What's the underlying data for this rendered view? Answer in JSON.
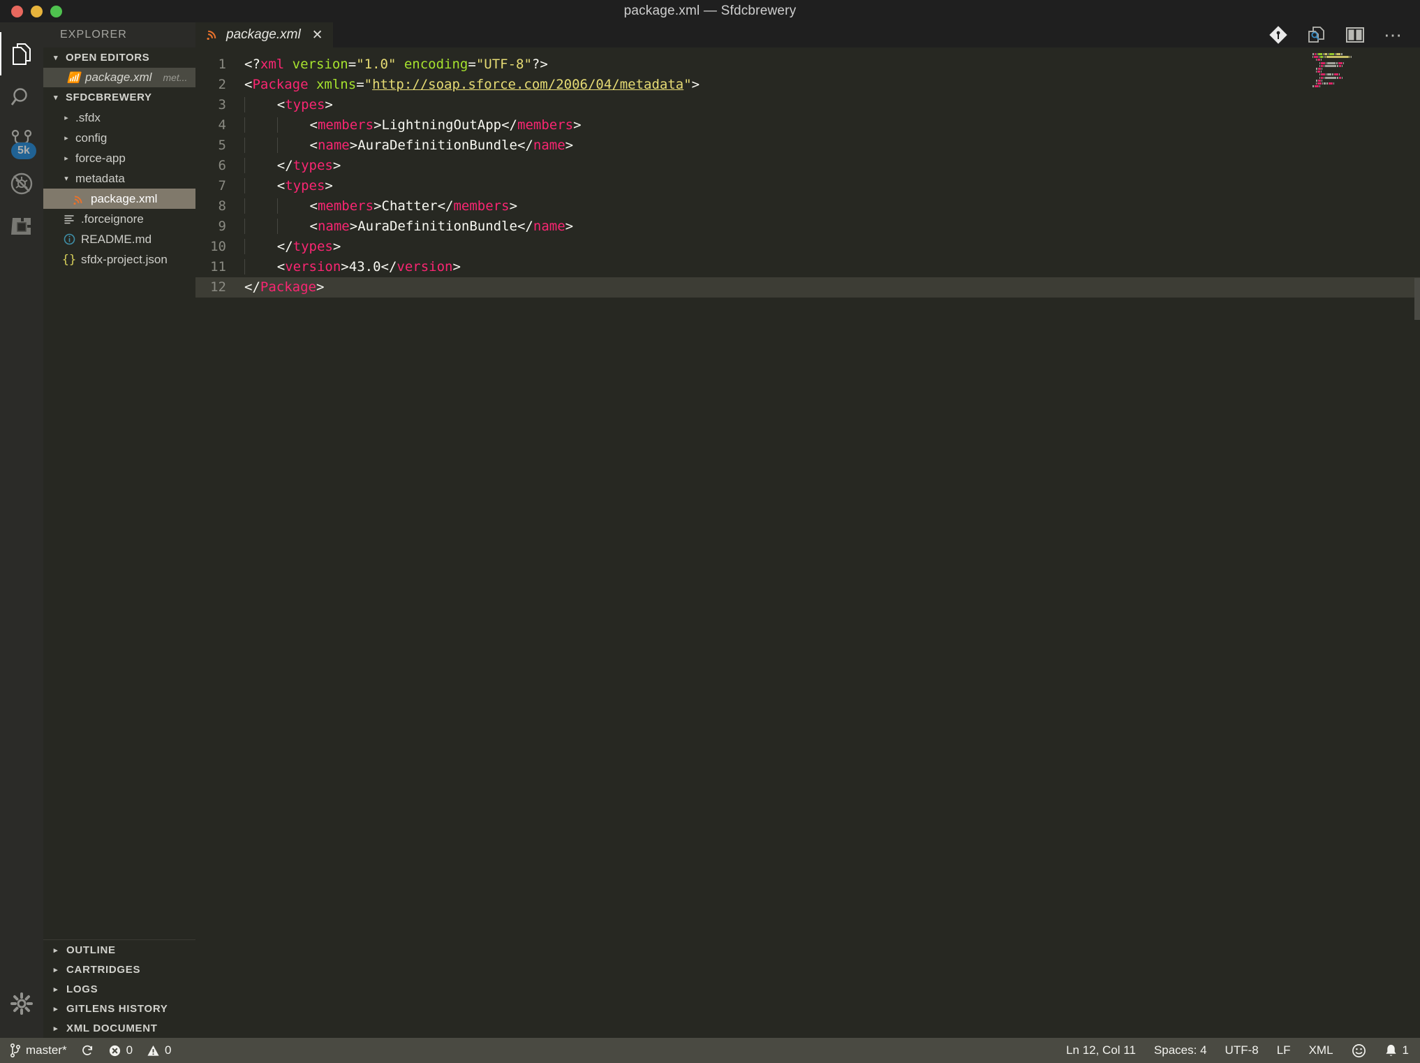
{
  "window": {
    "title": "package.xml — Sfdcbrewery",
    "traffic_lights": [
      "close-red",
      "minimize-yellow",
      "maximize-green"
    ]
  },
  "activitybar": {
    "items": [
      {
        "name": "explorer",
        "icon": "files-icon",
        "active": true,
        "badge": null
      },
      {
        "name": "search",
        "icon": "search-icon",
        "active": false,
        "badge": null
      },
      {
        "name": "source-control",
        "icon": "source-control-icon",
        "active": false,
        "badge": "5k"
      },
      {
        "name": "debug",
        "icon": "debug-no-entry-icon",
        "active": false,
        "badge": null
      },
      {
        "name": "extensions",
        "icon": "extensions-icon",
        "active": false,
        "badge": null
      }
    ],
    "manage": {
      "name": "settings-gear",
      "icon": "gear-icon"
    }
  },
  "sidebar": {
    "title": "EXPLORER",
    "open_editors": {
      "label": "OPEN EDITORS",
      "expanded": true,
      "items": [
        {
          "icon": "xml-file-icon",
          "name": "package.xml",
          "path": "met...",
          "active": true
        }
      ]
    },
    "project": {
      "label": "SFDCBREWERY",
      "expanded": true,
      "tree": [
        {
          "label": ".sfdx",
          "type": "folder",
          "expanded": false,
          "depth": 1,
          "icon": "chevron-right-icon"
        },
        {
          "label": "config",
          "type": "folder",
          "expanded": false,
          "depth": 1,
          "icon": "chevron-right-icon"
        },
        {
          "label": "force-app",
          "type": "folder",
          "expanded": false,
          "depth": 1,
          "icon": "chevron-right-icon"
        },
        {
          "label": "metadata",
          "type": "folder",
          "expanded": true,
          "depth": 1,
          "icon": "chevron-down-icon"
        },
        {
          "label": "package.xml",
          "type": "file",
          "depth": 2,
          "icon": "xml-file-icon",
          "selected": true
        },
        {
          "label": ".forceignore",
          "type": "file",
          "depth": 1,
          "icon": "text-file-icon"
        },
        {
          "label": "README.md",
          "type": "file",
          "depth": 1,
          "icon": "info-circle-icon"
        },
        {
          "label": "sfdx-project.json",
          "type": "file",
          "depth": 1,
          "icon": "json-braces-icon"
        }
      ]
    },
    "panels": [
      {
        "label": "OUTLINE",
        "expanded": false,
        "icon": "chevron-right-icon"
      },
      {
        "label": "CARTRIDGES",
        "expanded": false,
        "icon": "chevron-right-icon"
      },
      {
        "label": "LOGS",
        "expanded": false,
        "icon": "chevron-right-icon"
      },
      {
        "label": "GITLENS HISTORY",
        "expanded": false,
        "icon": "chevron-right-icon"
      },
      {
        "label": "XML DOCUMENT",
        "expanded": false,
        "icon": "chevron-right-icon"
      }
    ]
  },
  "editor": {
    "tabs": [
      {
        "label": "package.xml",
        "icon": "xml-file-icon",
        "active": true,
        "dirty": false,
        "close": "✕"
      }
    ],
    "actions": [
      {
        "name": "source-control-action",
        "icon": "git-diamond-icon"
      },
      {
        "name": "find-in-file-action",
        "icon": "search-document-icon"
      },
      {
        "name": "split-editor-action",
        "icon": "split-editor-icon"
      },
      {
        "name": "more-actions",
        "icon": "ellipsis-icon"
      }
    ],
    "lines": [
      {
        "n": 1,
        "indent": 0,
        "tokens": [
          {
            "t": "<?",
            "c": "plain"
          },
          {
            "t": "xml",
            "c": "tag"
          },
          {
            "t": " ",
            "c": "plain"
          },
          {
            "t": "version",
            "c": "attr"
          },
          {
            "t": "=",
            "c": "plain"
          },
          {
            "t": "\"1.0\"",
            "c": "str"
          },
          {
            "t": " ",
            "c": "plain"
          },
          {
            "t": "encoding",
            "c": "attr"
          },
          {
            "t": "=",
            "c": "plain"
          },
          {
            "t": "\"UTF-8\"",
            "c": "str"
          },
          {
            "t": "?>",
            "c": "plain"
          }
        ]
      },
      {
        "n": 2,
        "indent": 0,
        "tokens": [
          {
            "t": "<",
            "c": "plain"
          },
          {
            "t": "Package",
            "c": "tag"
          },
          {
            "t": " ",
            "c": "plain"
          },
          {
            "t": "xmlns",
            "c": "attr"
          },
          {
            "t": "=",
            "c": "plain"
          },
          {
            "t": "\"",
            "c": "str"
          },
          {
            "t": "http://soap.sforce.com/2006/04/metadata",
            "c": "link"
          },
          {
            "t": "\"",
            "c": "str"
          },
          {
            "t": ">",
            "c": "plain"
          }
        ]
      },
      {
        "n": 3,
        "indent": 1,
        "tokens": [
          {
            "t": "<",
            "c": "plain"
          },
          {
            "t": "types",
            "c": "tag"
          },
          {
            "t": ">",
            "c": "plain"
          }
        ]
      },
      {
        "n": 4,
        "indent": 2,
        "tokens": [
          {
            "t": "<",
            "c": "plain"
          },
          {
            "t": "members",
            "c": "tag"
          },
          {
            "t": ">",
            "c": "plain"
          },
          {
            "t": "LightningOutApp",
            "c": "plain"
          },
          {
            "t": "</",
            "c": "plain"
          },
          {
            "t": "members",
            "c": "tag"
          },
          {
            "t": ">",
            "c": "plain"
          }
        ]
      },
      {
        "n": 5,
        "indent": 2,
        "tokens": [
          {
            "t": "<",
            "c": "plain"
          },
          {
            "t": "name",
            "c": "tag"
          },
          {
            "t": ">",
            "c": "plain"
          },
          {
            "t": "AuraDefinitionBundle",
            "c": "plain"
          },
          {
            "t": "</",
            "c": "plain"
          },
          {
            "t": "name",
            "c": "tag"
          },
          {
            "t": ">",
            "c": "plain"
          }
        ]
      },
      {
        "n": 6,
        "indent": 1,
        "tokens": [
          {
            "t": "</",
            "c": "plain"
          },
          {
            "t": "types",
            "c": "tag"
          },
          {
            "t": ">",
            "c": "plain"
          }
        ]
      },
      {
        "n": 7,
        "indent": 1,
        "tokens": [
          {
            "t": "<",
            "c": "plain"
          },
          {
            "t": "types",
            "c": "tag"
          },
          {
            "t": ">",
            "c": "plain"
          }
        ]
      },
      {
        "n": 8,
        "indent": 2,
        "tokens": [
          {
            "t": "<",
            "c": "plain"
          },
          {
            "t": "members",
            "c": "tag"
          },
          {
            "t": ">",
            "c": "plain"
          },
          {
            "t": "Chatter",
            "c": "plain"
          },
          {
            "t": "</",
            "c": "plain"
          },
          {
            "t": "members",
            "c": "tag"
          },
          {
            "t": ">",
            "c": "plain"
          }
        ]
      },
      {
        "n": 9,
        "indent": 2,
        "tokens": [
          {
            "t": "<",
            "c": "plain"
          },
          {
            "t": "name",
            "c": "tag"
          },
          {
            "t": ">",
            "c": "plain"
          },
          {
            "t": "AuraDefinitionBundle",
            "c": "plain"
          },
          {
            "t": "</",
            "c": "plain"
          },
          {
            "t": "name",
            "c": "tag"
          },
          {
            "t": ">",
            "c": "plain"
          }
        ]
      },
      {
        "n": 10,
        "indent": 1,
        "tokens": [
          {
            "t": "</",
            "c": "plain"
          },
          {
            "t": "types",
            "c": "tag"
          },
          {
            "t": ">",
            "c": "plain"
          }
        ]
      },
      {
        "n": 11,
        "indent": 1,
        "tokens": [
          {
            "t": "<",
            "c": "plain"
          },
          {
            "t": "version",
            "c": "tag"
          },
          {
            "t": ">",
            "c": "plain"
          },
          {
            "t": "43.0",
            "c": "plain"
          },
          {
            "t": "</",
            "c": "plain"
          },
          {
            "t": "version",
            "c": "tag"
          },
          {
            "t": ">",
            "c": "plain"
          }
        ]
      },
      {
        "n": 12,
        "indent": 0,
        "current": true,
        "tokens": [
          {
            "t": "</",
            "c": "plain"
          },
          {
            "t": "Package",
            "c": "tag"
          },
          {
            "t": ">",
            "c": "plain"
          }
        ]
      }
    ]
  },
  "statusbar": {
    "left": [
      {
        "name": "git-branch",
        "icon": "git-branch-icon",
        "label": "master*"
      },
      {
        "name": "sync-changes",
        "icon": "sync-icon",
        "label": ""
      },
      {
        "name": "errors",
        "icon": "error-circle-icon",
        "label": "0"
      },
      {
        "name": "warnings",
        "icon": "warning-triangle-icon",
        "label": "0"
      }
    ],
    "right": [
      {
        "name": "cursor-position",
        "label": "Ln 12, Col 11"
      },
      {
        "name": "indentation",
        "label": "Spaces: 4"
      },
      {
        "name": "encoding",
        "label": "UTF-8"
      },
      {
        "name": "eol",
        "label": "LF"
      },
      {
        "name": "language-mode",
        "label": "XML"
      },
      {
        "name": "feedback-smiley",
        "icon": "smiley-icon",
        "label": ""
      },
      {
        "name": "notifications",
        "icon": "bell-icon",
        "label": "1"
      }
    ]
  },
  "colors": {
    "background": "#272822",
    "titlebar": "#1f1f1f",
    "activitybar": "#2b2b28",
    "statusbar": "#4a4a42",
    "selection": "#80796b",
    "badge": "#1a85d6",
    "xml_icon": "#e8722c",
    "tag": "#f92672",
    "attr": "#a6e22e",
    "string": "#e6db74",
    "text": "#f8f8f2"
  }
}
